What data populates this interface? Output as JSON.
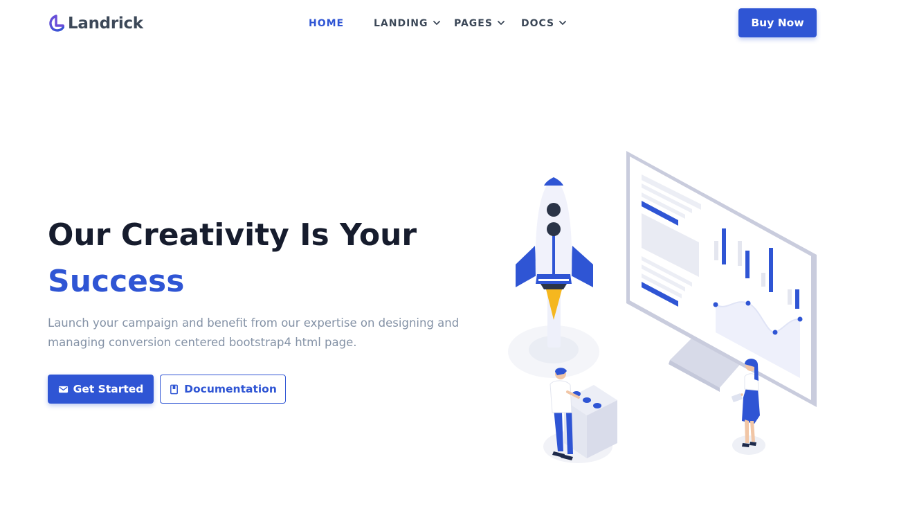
{
  "brand": {
    "name": "Landrick"
  },
  "nav": {
    "items": [
      {
        "label": "HOME",
        "active": true,
        "has_dropdown": false
      },
      {
        "label": "LANDING",
        "active": false,
        "has_dropdown": true
      },
      {
        "label": "PAGES",
        "active": false,
        "has_dropdown": true
      },
      {
        "label": "DOCS",
        "active": false,
        "has_dropdown": true
      }
    ],
    "cta_label": "Buy Now"
  },
  "hero": {
    "title_line1": "Our Creativity Is Your",
    "title_line2": "Success",
    "description": "Launch your campaign and benefit from our expertise on designing and managing conversion centered bootstrap4 html page.",
    "primary_button": {
      "label": "Get Started",
      "icon": "mail-icon"
    },
    "secondary_button": {
      "label": "Documentation",
      "icon": "book-icon"
    }
  },
  "colors": {
    "primary": "#2f55d4",
    "heading": "#161c2d",
    "muted": "#8492a6",
    "accent_yellow": "#f5b71f"
  }
}
